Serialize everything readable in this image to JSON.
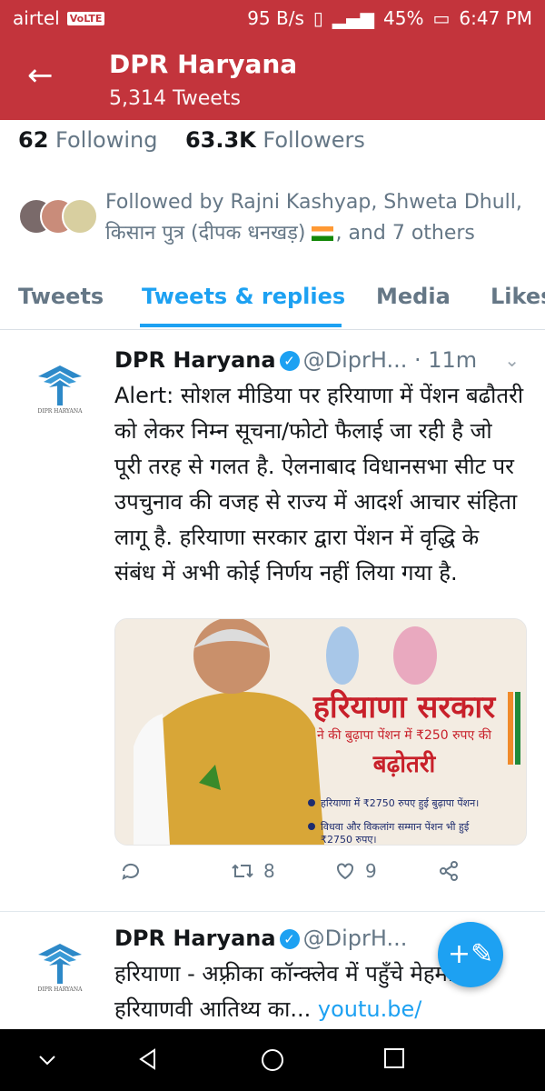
{
  "status": {
    "carrier": "airtel",
    "volte": "VoLTE",
    "speed": "95 B/s",
    "battery": "45%",
    "time": "6:47 PM"
  },
  "header": {
    "title": "DPR Haryana",
    "subtitle": "5,314 Tweets"
  },
  "profile": {
    "following_count": "62",
    "following_label": "Following",
    "followers_count": "63.3K",
    "followers_label": "Followers"
  },
  "followed_by": {
    "line1": "Followed by Rajni Kashyap, Shweta Dhull,",
    "line2_a": "किसान पुत्र (दीपक धनखड़)",
    "line2_b": ", and 7 others"
  },
  "tabs": [
    "Tweets",
    "Tweets & replies",
    "Media",
    "Likes"
  ],
  "tweets": [
    {
      "name": "DPR Haryana",
      "handle": "@DiprH...",
      "time": "· 11m",
      "text": "Alert: सोशल मीडिया पर हरियाणा में पेंशन बढौतरी को लेकर निम्न सूचना/फोटो फैलाई जा रही है जो पूरी तरह से गलत है. ऐलनाबाद विधानसभा सीट पर उपचुनाव की वजह से राज्य में आदर्श आचार संहिता लागू है. हरियाणा सरकार द्वारा पेंशन में वृद्धि के संबंध में अभी कोई निर्णय नहीं लिया गया है.",
      "media": {
        "headline": "हरियाणा सरकार",
        "subline": "ने की बुढ़ापा पेंशन में ₹250 रुपए की",
        "headline2": "बढ़ोतरी",
        "bullet1": "हरियाणा में ₹2750 रुपए हुई बुढ़ापा पेंशन।",
        "bullet2": "विधवा और विकलांग सम्मान पेंशन भी हुई",
        "bullet2_cont": "₹2750 रुपए।"
      },
      "retweets": "8",
      "likes": "9"
    },
    {
      "name": "DPR Haryana",
      "handle": "@DiprH...",
      "text": "हरियाणा - अफ़्रीका कॉन्क्लेव में पहुँचे मेहमान हरियाणवी आतिथ्य का...",
      "link": "youtu.be/"
    }
  ],
  "logo_text": "DIPR HARYANA",
  "colors": {
    "header": "#c3343c",
    "accent": "#1da1f2",
    "text": "#14171a",
    "muted": "#657786"
  }
}
